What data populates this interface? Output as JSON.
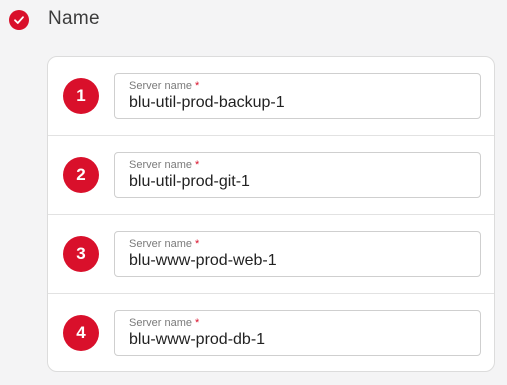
{
  "step": {
    "title": "Name",
    "status_icon": "check-icon",
    "accent_color": "#d9102b"
  },
  "servers": [
    {
      "number": "1",
      "label": "Server name",
      "required_mark": "*",
      "value": "blu-util-prod-backup-1"
    },
    {
      "number": "2",
      "label": "Server name",
      "required_mark": "*",
      "value": "blu-util-prod-git-1"
    },
    {
      "number": "3",
      "label": "Server name",
      "required_mark": "*",
      "value": "blu-www-prod-web-1"
    },
    {
      "number": "4",
      "label": "Server name",
      "required_mark": "*",
      "value": "blu-www-prod-db-1"
    }
  ]
}
